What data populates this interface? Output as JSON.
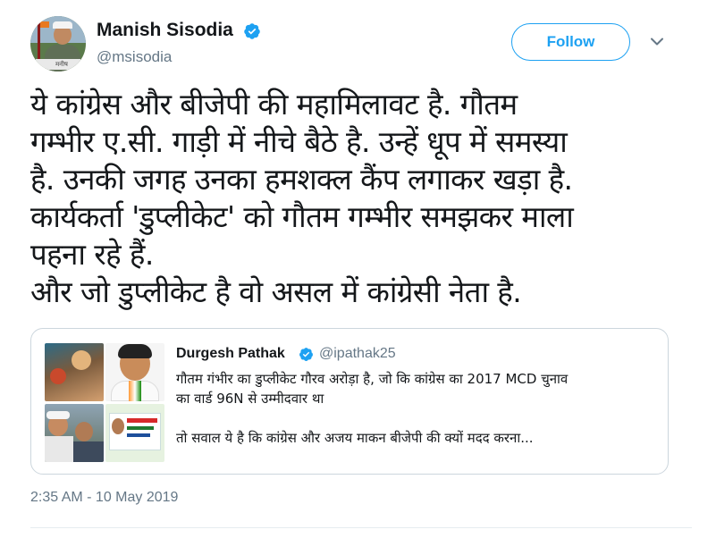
{
  "author": {
    "name": "Manish Sisodia",
    "handle": "@msisodia",
    "avatar_caption": "मनीष"
  },
  "follow_button": {
    "label": "Follow"
  },
  "tweet": {
    "text": "ये कांग्रेस और बीजेपी की महामिलावट है. गौतम\nगम्भीर ए.सी. गाड़ी में नीचे बैठे है. उन्हें धूप में समस्या\nहै. उनकी जगह उनका हमशक्ल कैंप लगाकर खड़ा है.\nकार्यकर्ता 'डुप्लीकेट' को गौतम गम्भीर समझकर माला\nपहना रहे हैं.\nऔर जो डुप्लीकेट है वो असल में कांग्रेसी नेता है.",
    "timestamp": "2:35 AM - 10 May 2019"
  },
  "quoted_tweet": {
    "name": "Durgesh Pathak",
    "handle": "@ipathak25",
    "text": "गौतम गंभीर का डुप्लीकेट गौरव अरोड़ा है, जो कि कांग्रेस का 2017 MCD चुनाव\nका वार्ड 96N से उम्मीदवार था\n\nतो सवाल ये है कि कांग्रेस और अजय माकन बीजेपी की क्यों मदद करना..."
  },
  "colors": {
    "accent": "#1da1f2",
    "text_primary": "#14171a",
    "text_secondary": "#657786",
    "border": "#ccd6dd"
  },
  "icons": {
    "verified": "verified-badge-icon",
    "caret": "chevron-down-icon"
  }
}
